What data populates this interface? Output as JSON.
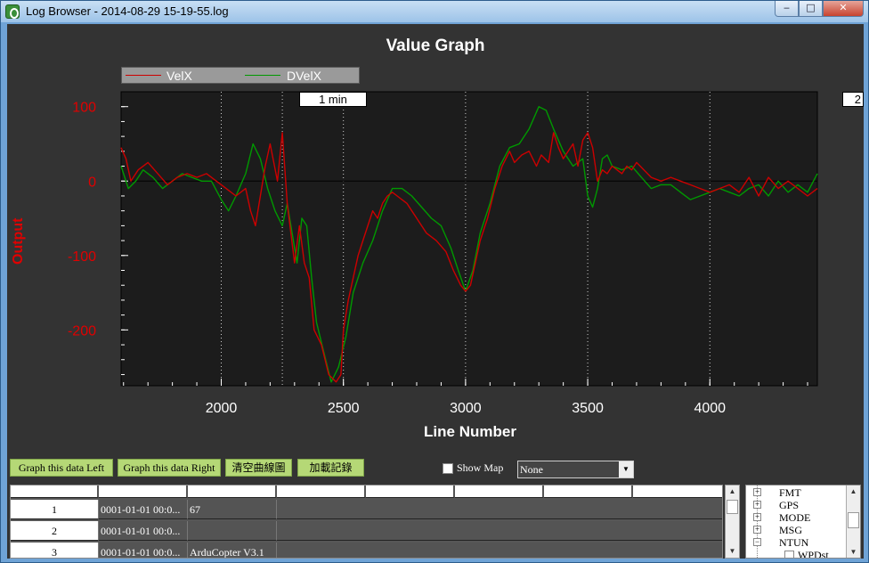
{
  "window": {
    "title": "Log Browser - 2014-08-29 15-19-55.log",
    "minimize_glyph": "‒",
    "maximize_glyph": "□",
    "close_glyph": "✕"
  },
  "graph": {
    "legend": [
      {
        "name": "VelX",
        "color": "#cc0000"
      },
      {
        "name": "DVelX",
        "color": "#009900"
      }
    ],
    "time_label": "1 min",
    "time_label_2": "2"
  },
  "chart_data": {
    "type": "line",
    "title": "Value Graph",
    "xlabel": "Line Number",
    "ylabel": "Output",
    "xlim": [
      1590,
      4440
    ],
    "ylim": [
      -275,
      120
    ],
    "x_ticks": [
      2000,
      2500,
      3000,
      3500,
      4000
    ],
    "y_ticks": [
      100,
      0,
      -100,
      -200
    ],
    "grid": "vertical dotted",
    "legend_position": "top-left",
    "series": [
      {
        "name": "VelX",
        "color": "#cc0000",
        "x": [
          1590,
          1610,
          1630,
          1660,
          1700,
          1740,
          1780,
          1820,
          1860,
          1900,
          1940,
          1980,
          2020,
          2060,
          2100,
          2120,
          2140,
          2160,
          2180,
          2200,
          2230,
          2250,
          2270,
          2300,
          2320,
          2340,
          2360,
          2380,
          2410,
          2440,
          2470,
          2490,
          2500,
          2520,
          2540,
          2560,
          2580,
          2600,
          2620,
          2640,
          2660,
          2680,
          2700,
          2720,
          2760,
          2800,
          2840,
          2880,
          2920,
          2950,
          2980,
          3000,
          3020,
          3040,
          3060,
          3090,
          3120,
          3150,
          3180,
          3200,
          3230,
          3260,
          3290,
          3310,
          3340,
          3360,
          3380,
          3400,
          3420,
          3440,
          3460,
          3480,
          3500,
          3520,
          3540,
          3560,
          3580,
          3600,
          3620,
          3640,
          3660,
          3680,
          3700,
          3730,
          3760,
          3800,
          3840,
          3880,
          3920,
          3960,
          4000,
          4040,
          4080,
          4120,
          4160,
          4200,
          4240,
          4280,
          4320,
          4360,
          4400,
          4440
        ],
        "y": [
          45,
          30,
          0,
          15,
          25,
          10,
          -5,
          5,
          10,
          5,
          10,
          0,
          -10,
          -20,
          -10,
          -40,
          -60,
          -20,
          20,
          50,
          0,
          65,
          -30,
          -110,
          -60,
          -110,
          -130,
          -200,
          -220,
          -260,
          -270,
          -260,
          -200,
          -160,
          -130,
          -100,
          -80,
          -60,
          -40,
          -50,
          -30,
          -20,
          -15,
          -20,
          -30,
          -50,
          -70,
          -80,
          -95,
          -120,
          -140,
          -148,
          -140,
          -110,
          -80,
          -50,
          -10,
          20,
          40,
          25,
          35,
          40,
          20,
          35,
          25,
          65,
          45,
          30,
          40,
          50,
          20,
          55,
          65,
          45,
          0,
          15,
          10,
          20,
          15,
          10,
          20,
          15,
          25,
          15,
          5,
          0,
          5,
          0,
          -5,
          -10,
          -15,
          -10,
          -5,
          -15,
          5,
          -20,
          5,
          -10,
          0,
          -10,
          -20,
          -10
        ]
      },
      {
        "name": "DVelX",
        "color": "#009900",
        "x": [
          1590,
          1620,
          1650,
          1680,
          1720,
          1760,
          1800,
          1840,
          1880,
          1920,
          1960,
          2000,
          2030,
          2060,
          2100,
          2130,
          2160,
          2190,
          2220,
          2250,
          2270,
          2290,
          2310,
          2330,
          2350,
          2370,
          2390,
          2420,
          2450,
          2480,
          2510,
          2540,
          2580,
          2620,
          2660,
          2700,
          2740,
          2780,
          2820,
          2860,
          2900,
          2940,
          2970,
          3000,
          3030,
          3060,
          3100,
          3140,
          3180,
          3220,
          3260,
          3300,
          3330,
          3360,
          3400,
          3440,
          3480,
          3500,
          3520,
          3540,
          3560,
          3580,
          3600,
          3640,
          3680,
          3720,
          3760,
          3800,
          3840,
          3880,
          3920,
          3960,
          4000,
          4040,
          4080,
          4120,
          4160,
          4200,
          4240,
          4280,
          4320,
          4360,
          4400,
          4440
        ],
        "y": [
          20,
          -10,
          0,
          15,
          5,
          -10,
          0,
          10,
          5,
          0,
          0,
          -25,
          -40,
          -20,
          10,
          50,
          30,
          -10,
          -40,
          -60,
          -30,
          -70,
          -110,
          -50,
          -60,
          -130,
          -190,
          -230,
          -270,
          -250,
          -210,
          -150,
          -110,
          -80,
          -40,
          -10,
          -10,
          -20,
          -35,
          -50,
          -60,
          -90,
          -120,
          -148,
          -120,
          -70,
          -30,
          20,
          45,
          50,
          70,
          100,
          95,
          70,
          40,
          20,
          30,
          -20,
          -35,
          -10,
          30,
          35,
          20,
          15,
          20,
          5,
          -10,
          -5,
          -5,
          -15,
          -25,
          -20,
          -15,
          -10,
          -15,
          -20,
          -10,
          -5,
          -20,
          0,
          -15,
          -5,
          -15,
          10
        ]
      }
    ]
  },
  "toolbar": {
    "graph_left_label": "Graph this data Left",
    "graph_right_label": "Graph this data Right",
    "clear_label": "清空曲線圖",
    "load_label": "加載記錄",
    "show_map_label": "Show Map",
    "map_select_value": "None"
  },
  "grid": {
    "rows": [
      {
        "num": "1",
        "time": "0001-01-01 00:0...",
        "value": "67"
      },
      {
        "num": "2",
        "time": "0001-01-01 00:0...",
        "value": ""
      },
      {
        "num": "3",
        "time": "0001-01-01 00:0...",
        "value": "ArduCopter V3.1"
      }
    ]
  },
  "tree": {
    "items": [
      "FMT",
      "GPS",
      "MODE",
      "MSG",
      "NTUN"
    ],
    "child": "WPDst"
  }
}
